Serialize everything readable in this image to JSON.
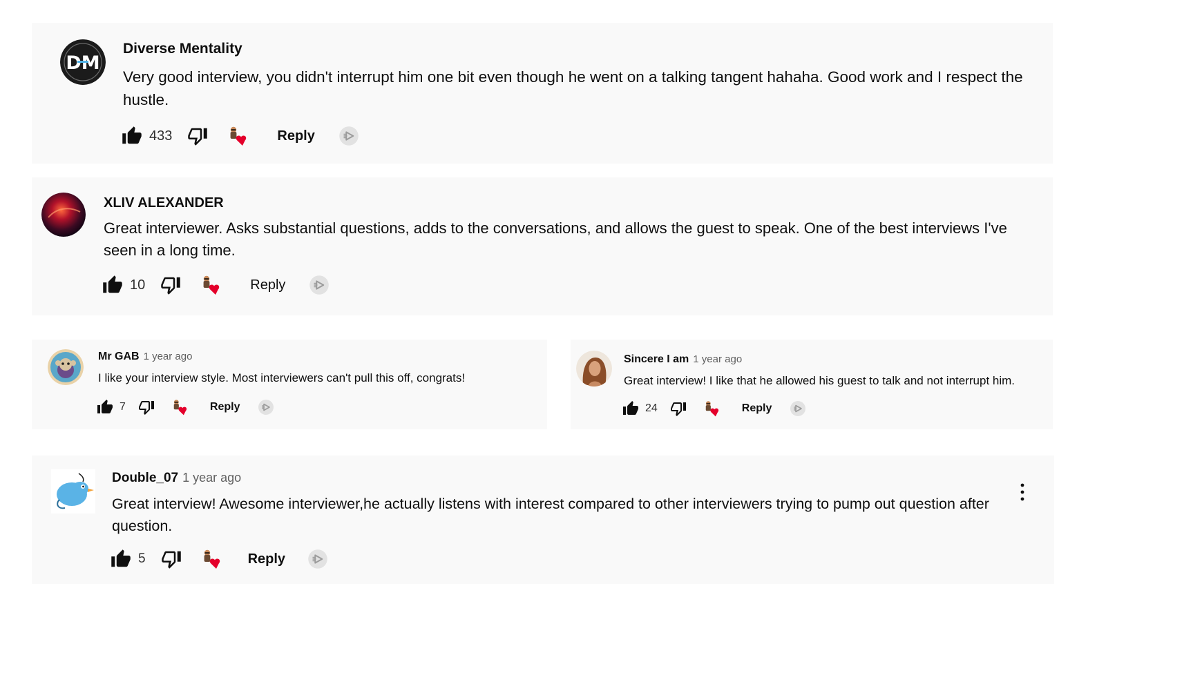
{
  "colors": {
    "card_bg": "#f9f9f9",
    "heart": "#e4002b",
    "muted": "#606060"
  },
  "comments": [
    {
      "author": "Diverse Mentality",
      "time": "",
      "text": "Very good interview, you didn't interrupt him one bit even though he went on a talking tangent hahaha. Good work and I respect the hustle.",
      "likes": "433",
      "reply_label": "Reply",
      "avatar_icon": "diverse-mentality-logo",
      "avatar_text": "DM"
    },
    {
      "author": "XLIV ALEXANDER",
      "time": "",
      "text": "Great interviewer. Asks substantial questions, adds to the conversations, and allows the guest to speak. One of the best interviews I've seen in a long time.",
      "likes": "10",
      "reply_label": "Reply",
      "avatar_icon": "red-abstract-avatar"
    },
    {
      "author": "Mr GAB",
      "time": "1 year ago",
      "text": "I like your interview style. Most interviewers can't pull this off, congrats!",
      "likes": "7",
      "reply_label": "Reply",
      "avatar_icon": "cartoon-monkey-avatar"
    },
    {
      "author": "Sincere I am",
      "time": "1 year ago",
      "text": "Great interview! I like that he allowed his guest to talk and not interrupt him.",
      "likes": "24",
      "reply_label": "Reply",
      "avatar_icon": "woman-portrait-avatar"
    },
    {
      "author": "Double_07",
      "time": "1 year ago",
      "text": "Great interview! Awesome interviewer,he actually listens with interest compared to other interviewers trying to pump out question after question.",
      "likes": "5",
      "reply_label": "Reply",
      "avatar_icon": "blue-bird-avatar"
    }
  ]
}
